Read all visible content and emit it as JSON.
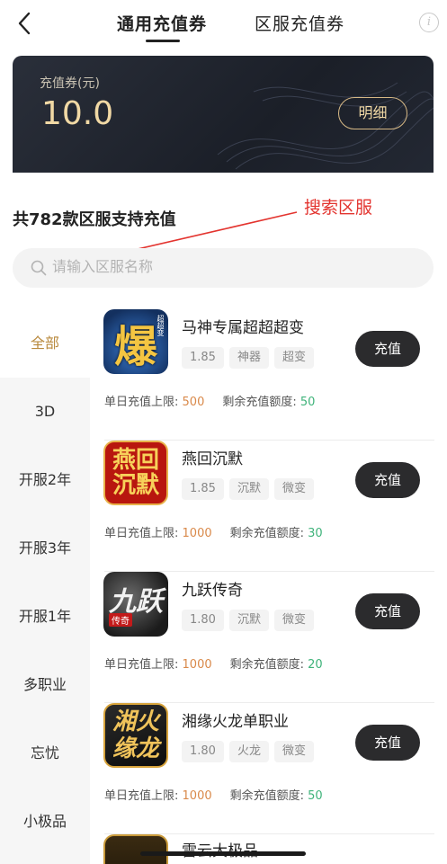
{
  "header": {
    "tabs": [
      {
        "label": "通用充值券",
        "active": true
      },
      {
        "label": "区服充值券",
        "active": false
      }
    ]
  },
  "card": {
    "label": "充值券(元)",
    "value": "10.0",
    "detail_button": "明细"
  },
  "summary": {
    "count_text": "共782款区服支持充值"
  },
  "annotation": {
    "text": "搜索区服",
    "color": "#e3342f"
  },
  "search": {
    "placeholder": "请输入区服名称",
    "value": ""
  },
  "sidebar": {
    "items": [
      {
        "label": "全部",
        "active": true
      },
      {
        "label": "3D",
        "active": false
      },
      {
        "label": "开服2年",
        "active": false
      },
      {
        "label": "开服3年",
        "active": false
      },
      {
        "label": "开服1年",
        "active": false
      },
      {
        "label": "多职业",
        "active": false
      },
      {
        "label": "忘忧",
        "active": false
      },
      {
        "label": "小极品",
        "active": false
      }
    ]
  },
  "games": [
    {
      "name": "马神专属超超超变",
      "tags": [
        "1.85",
        "神器",
        "超变"
      ],
      "button": "充值",
      "limit_label": "单日充值上限:",
      "limit_value": "500",
      "remain_label": "剩余充值额度:",
      "remain_value": "50",
      "icon_glyph": "爆",
      "icon_sub": "超超变"
    },
    {
      "name": "燕回沉默",
      "tags": [
        "1.85",
        "沉默",
        "微变"
      ],
      "button": "充值",
      "limit_label": "单日充值上限:",
      "limit_value": "1000",
      "remain_label": "剩余充值额度:",
      "remain_value": "30",
      "icon_glyph": "燕回沉默"
    },
    {
      "name": "九跃传奇",
      "tags": [
        "1.80",
        "沉默",
        "微变"
      ],
      "button": "充值",
      "limit_label": "单日充值上限:",
      "limit_value": "1000",
      "remain_label": "剩余充值额度:",
      "remain_value": "20",
      "icon_glyph": "九跃",
      "icon_sub": "传奇"
    },
    {
      "name": "湘缘火龙单职业",
      "tags": [
        "1.80",
        "火龙",
        "微变"
      ],
      "button": "充值",
      "limit_label": "单日充值上限:",
      "limit_value": "1000",
      "remain_label": "剩余充值额度:",
      "remain_value": "50",
      "icon_glyph": "湘火缘龙"
    },
    {
      "name": "雷云大极品",
      "tags": [],
      "button": "",
      "partial": true
    }
  ],
  "colors": {
    "accent_gold": "#b98a3e",
    "limit_orange": "#d9894a",
    "remain_green": "#3fb37a"
  }
}
